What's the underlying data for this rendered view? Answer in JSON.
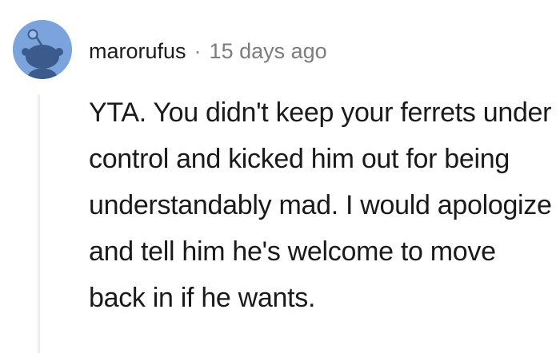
{
  "comment": {
    "author": "marorufus",
    "separator": "·",
    "timestamp": "15 days ago",
    "avatar_icon": "snoo-avatar-icon",
    "body": "YTA. You didn't keep your ferrets under control and kicked him out for being understandably mad. I would apologize and tell him he's welcome to move back in if he wants."
  },
  "colors": {
    "avatar_bg": "#7ba4dd",
    "thread_line": "#edeff1",
    "timestamp": "#7c7c7c"
  }
}
